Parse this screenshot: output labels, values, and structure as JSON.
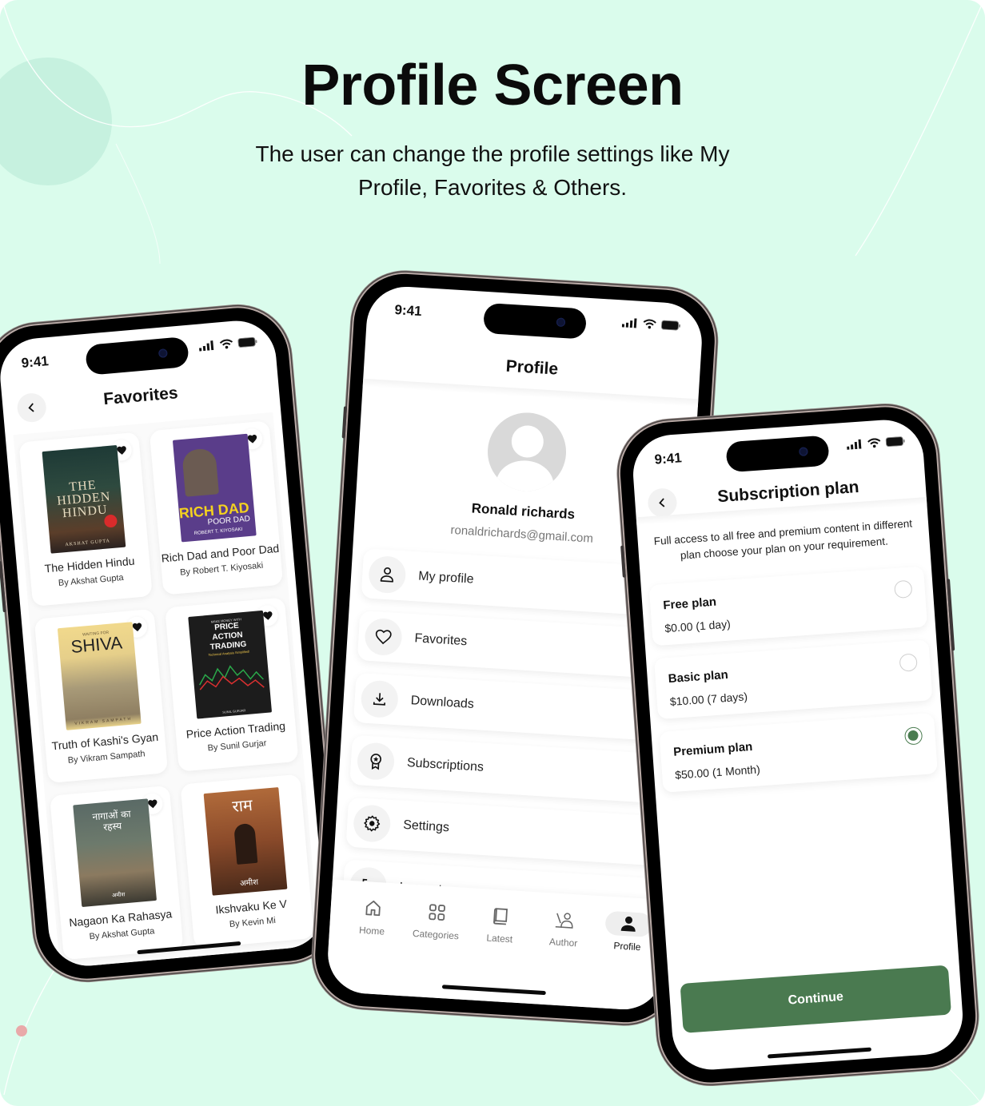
{
  "page": {
    "title": "Profile Screen",
    "subtitle": "The user can change the profile settings like My Profile, Favorites & Others.",
    "background_color": "#dafcec",
    "accent_color": "#4a7c50"
  },
  "status_bar": {
    "time": "9:41"
  },
  "favorites_screen": {
    "title": "Favorites",
    "books": [
      {
        "title": "The Hidden Hindu",
        "author": "By Akshat Gupta",
        "cover_text": "THE HIDDEN HINDU",
        "cover_sub": "AKSHAT GUPTA",
        "favorited": true,
        "icon": "heart-filled-icon"
      },
      {
        "title": "Rich Dad and Poor Dad",
        "author": "By Robert T. Kiyosaki",
        "cover_text": "RICH DAD",
        "cover_sub": "POOR DAD",
        "cover_author": "ROBERT T. KIYOSAKI",
        "favorited": true,
        "icon": "heart-filled-icon"
      },
      {
        "title": "Truth of Kashi's Gyan",
        "author": "By Vikram Sampath",
        "cover_top": "WAITING FOR",
        "cover_text": "SHIVA",
        "cover_sub": "VIKRAM SAMPATH",
        "favorited": true,
        "icon": "heart-filled-icon"
      },
      {
        "title": "Price Action Trading",
        "author": "By Sunil Gurjar",
        "cover_top": "MAKE MONEY WITH",
        "cover_text": "PRICE ACTION TRADING",
        "cover_sub": "Technical Analysis Simplified!",
        "cover_author": "SUNIL GURJAR",
        "favorited": true,
        "icon": "heart-filled-icon"
      },
      {
        "title": "Nagaon Ka Rahasya",
        "author": "By Akshat Gupta",
        "cover_text": "नागाओं का रहस्य",
        "cover_sub": "अमीश",
        "favorited": true,
        "icon": "heart-filled-icon"
      },
      {
        "title": "Ikshvaku Ke V",
        "author": "By Kevin Mi",
        "cover_text": "राम",
        "cover_sub": "अमीश",
        "favorited": false
      }
    ]
  },
  "profile_screen": {
    "title": "Profile",
    "user": {
      "name": "Ronald richards",
      "email": "ronaldrichards@gmail.com"
    },
    "menu": [
      {
        "label": "My profile",
        "icon": "user-icon",
        "chevron": false
      },
      {
        "label": "Favorites",
        "icon": "heart-icon",
        "chevron": false
      },
      {
        "label": "Downloads",
        "icon": "download-icon",
        "chevron": false
      },
      {
        "label": "Subscriptions",
        "icon": "award-icon",
        "chevron": true
      },
      {
        "label": "Settings",
        "icon": "gear-icon",
        "chevron": true
      },
      {
        "label": "Log out",
        "icon": "logout-icon",
        "chevron": true
      }
    ],
    "tabs": [
      {
        "label": "Home",
        "icon": "home-icon",
        "active": false
      },
      {
        "label": "Categories",
        "icon": "grid-icon",
        "active": false
      },
      {
        "label": "Latest",
        "icon": "book-icon",
        "active": false
      },
      {
        "label": "Author",
        "icon": "author-icon",
        "active": false
      },
      {
        "label": "Profile",
        "icon": "person-filled-icon",
        "active": true
      }
    ]
  },
  "subscription_screen": {
    "title": "Subscription plan",
    "description": "Full access to all free and premium content in different plan choose your plan on your requirement.",
    "plans": [
      {
        "name": "Free plan",
        "price": "$0.00 (1 day)",
        "selected": false
      },
      {
        "name": "Basic plan",
        "price": "$10.00 (7 days)",
        "selected": false
      },
      {
        "name": "Premium plan",
        "price": "$50.00 (1 Month)",
        "selected": true
      }
    ],
    "continue_label": "Continue",
    "button_color": "#4a7a50"
  }
}
